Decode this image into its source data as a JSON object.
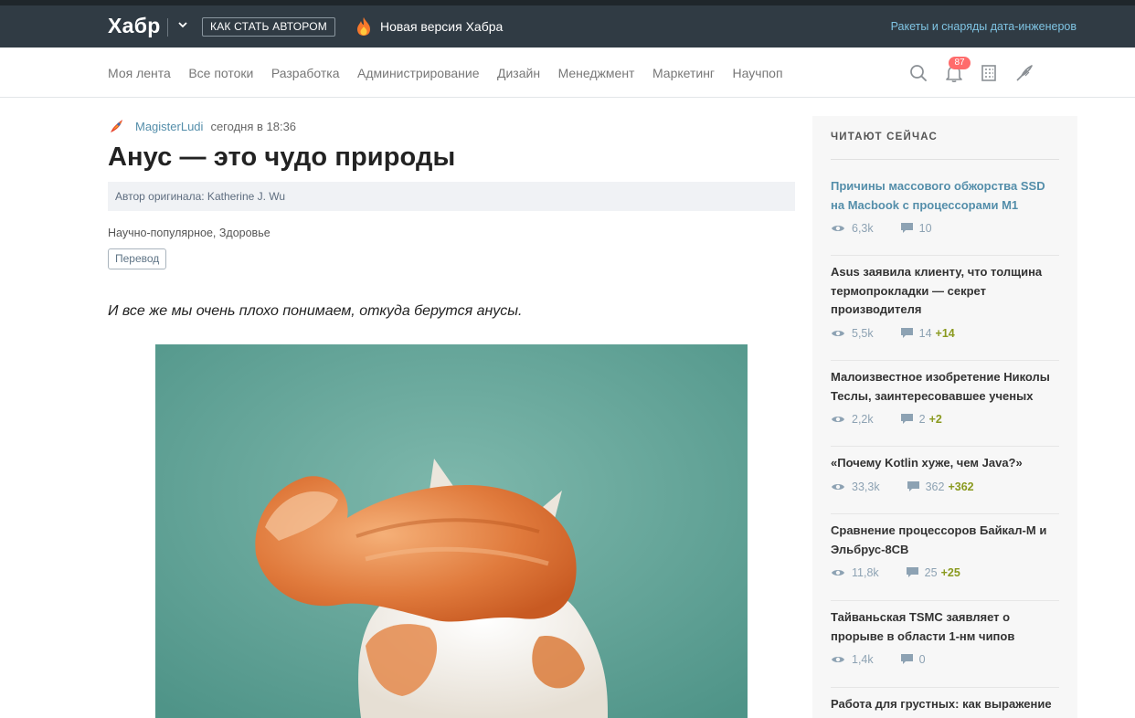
{
  "header": {
    "logo": "Хабр",
    "author_button": "КАК СТАТЬ АВТОРОМ",
    "new_version": "Новая версия Хабра",
    "promo": "Ракеты и снаряды дата-инженеров"
  },
  "nav": {
    "items": [
      "Моя лента",
      "Все потоки",
      "Разработка",
      "Администрирование",
      "Дизайн",
      "Менеджмент",
      "Маркетинг",
      "Научпоп"
    ],
    "notifications_count": "87"
  },
  "article": {
    "author": "MagisterLudi",
    "time": "сегодня в 18:36",
    "title": "Анус — это чудо природы",
    "original_author": "Автор оригинала: Katherine J. Wu",
    "hubs": "Научно-популярное,  Здоровье",
    "tag": "Перевод",
    "lead": "И все же мы очень плохо понимаем, откуда берутся анусы."
  },
  "sidebar": {
    "title": "ЧИТАЮТ СЕЙЧАС",
    "items": [
      {
        "title": "Причины массового обжорства SSD на Macbook с процессорами M1",
        "views": "6,3k",
        "comments": "10",
        "new": ""
      },
      {
        "title": "Asus заявила клиенту, что толщина термопрокладки — секрет производителя",
        "views": "5,5k",
        "comments": "14",
        "new": "+14"
      },
      {
        "title": "Малоизвестное изобретение Николы Теслы, заинтересовавшее ученых",
        "views": "2,2k",
        "comments": "2",
        "new": "+2"
      },
      {
        "title": "«Почему Kotlin хуже, чем Java?»",
        "views": "33,3k",
        "comments": "362",
        "new": "+362"
      },
      {
        "title": "Сравнение процессоров Байкал-М и Эльбрус-8СВ",
        "views": "11,8k",
        "comments": "25",
        "new": "+25"
      },
      {
        "title": "Тайваньская TSMC заявляет о прорыве в области 1-нм чипов",
        "views": "1,4k",
        "comments": "0",
        "new": ""
      },
      {
        "title": "Работа для грустных: как выражение",
        "views": "",
        "comments": "",
        "new": ""
      }
    ]
  }
}
